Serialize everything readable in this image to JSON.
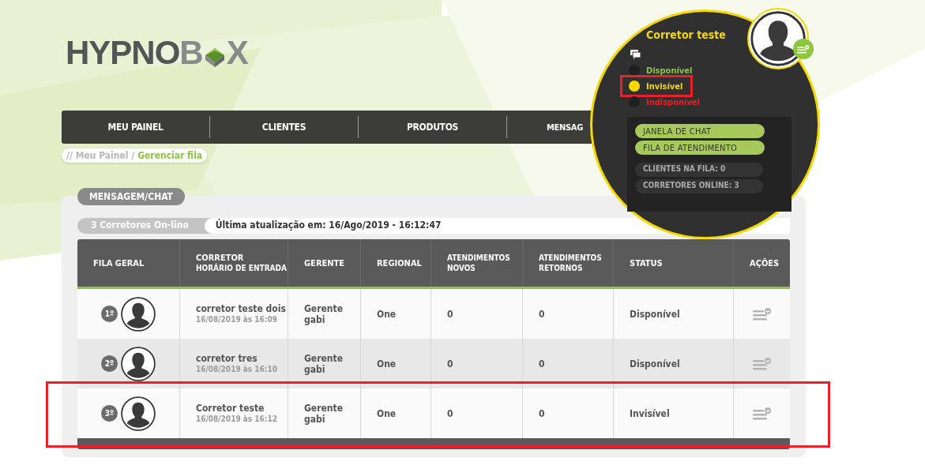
{
  "logo": {
    "part_1": "HYPNO",
    "part_2": "B",
    "part_3": "X"
  },
  "nav": [
    {
      "label": "MEU PAINEL"
    },
    {
      "label": "CLIENTES"
    },
    {
      "label": "PRODUTOS"
    },
    {
      "label": "MENSAG"
    }
  ],
  "breadcrumb": {
    "prefix": "// Meu Painel /",
    "current": "Gerenciar fila"
  },
  "panel": {
    "tab": "MENSAGEM/CHAT",
    "online_count": "3 Corretores On-line",
    "last_update": "Última atualização em: 16/Ago/2019 - 16:12:47"
  },
  "table": {
    "columns": [
      {
        "title": "FILA GERAL"
      },
      {
        "title": "CORRETOR",
        "subtitle": "HORÁRIO DE ENTRADA"
      },
      {
        "title": "GERENTE"
      },
      {
        "title": "REGIONAL"
      },
      {
        "title": "ATENDIMENTOS NOVOS"
      },
      {
        "title": "ATENDIMENTOS RETORNOS"
      },
      {
        "title": "STATUS"
      },
      {
        "title": "AÇÕES"
      }
    ],
    "rows": [
      {
        "position": "1º",
        "name": "corretor teste dois",
        "entry": "16/08/2019 às 16:09",
        "manager": "Gerente gabi",
        "regional": "One",
        "new": "0",
        "returns": "0",
        "status": "Disponível",
        "highlighted": false
      },
      {
        "position": "2º",
        "name": "corretor tres",
        "entry": "16/08/2019 às 16:10",
        "manager": "Gerente gabi",
        "regional": "One",
        "new": "0",
        "returns": "0",
        "status": "Disponível",
        "highlighted": false
      },
      {
        "position": "3º",
        "name": "Corretor teste",
        "entry": "16/08/2019 às 16:12",
        "manager": "Gerente gabi",
        "regional": "One",
        "new": "0",
        "returns": "0",
        "status": "Invisível",
        "highlighted": true
      }
    ]
  },
  "user_popup": {
    "name": "Corretor teste",
    "statuses": [
      {
        "label": "Disponível",
        "color": "#8cc63f",
        "selected": false,
        "highlighted": false
      },
      {
        "label": "Invisível",
        "color": "#f5d800",
        "selected": true,
        "highlighted": true
      },
      {
        "label": "Indisponível",
        "color": "#ed1c24",
        "selected": false,
        "highlighted": false
      }
    ],
    "buttons": [
      {
        "label": "JANELA DE CHAT"
      },
      {
        "label": "FILA DE ATENDIMENTO"
      }
    ],
    "stats": [
      {
        "label": "CLIENTES NA FILA: 0"
      },
      {
        "label": "CORRETORES ONLINE: 3"
      }
    ]
  }
}
